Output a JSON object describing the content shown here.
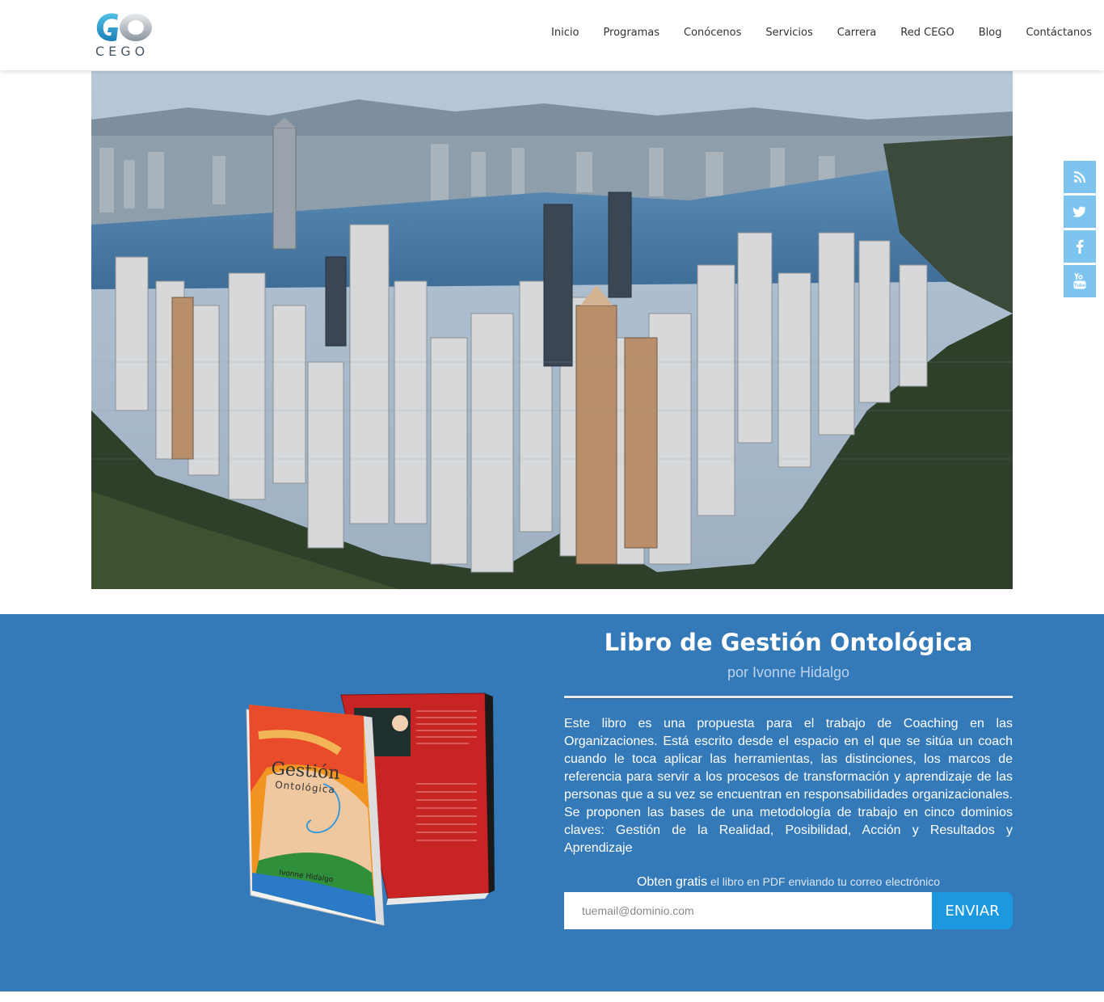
{
  "header": {
    "logo_text": "CEGO",
    "nav": [
      "Inicio",
      "Programas",
      "Conócenos",
      "Servicios",
      "Carrera",
      "Red CEGO",
      "Blog",
      "Contáctanos"
    ]
  },
  "social": [
    "rss-icon",
    "twitter-icon",
    "facebook-icon",
    "youtube-icon"
  ],
  "book": {
    "title": "Libro de Gestión Ontológica",
    "author": "por Ivonne Hidalgo",
    "cover_title": "Gestión",
    "cover_subtitle": "Ontológica",
    "cover_author": "Ivonne Hidalgo",
    "description": "Este libro es una propuesta para el trabajo de Coaching en las Organizaciones. Está escrito desde el espacio en el que se sitúa un coach cuando le toca aplicar las herramientas, las distinciones, los marcos de referencia para servir a los procesos de transformación y aprendizaje de las personas que a su vez se encuentran en responsabilidades organizacionales. Se proponen las bases de una metodología de trabajo en cinco dominios claves: Gestión de la Realidad, Posibilidad, Acción y Resultados y Aprendizaje",
    "promo_strong": "Obten gratis",
    "promo_rest": " el libro en PDF enviando tu correo electrónico",
    "email_placeholder": "tuemail@dominio.com",
    "send_label": "ENVIAR"
  },
  "colors": {
    "section_bg": "#3479b8",
    "social_bg": "#7dc4ef",
    "button_bg": "#1b98e0"
  }
}
